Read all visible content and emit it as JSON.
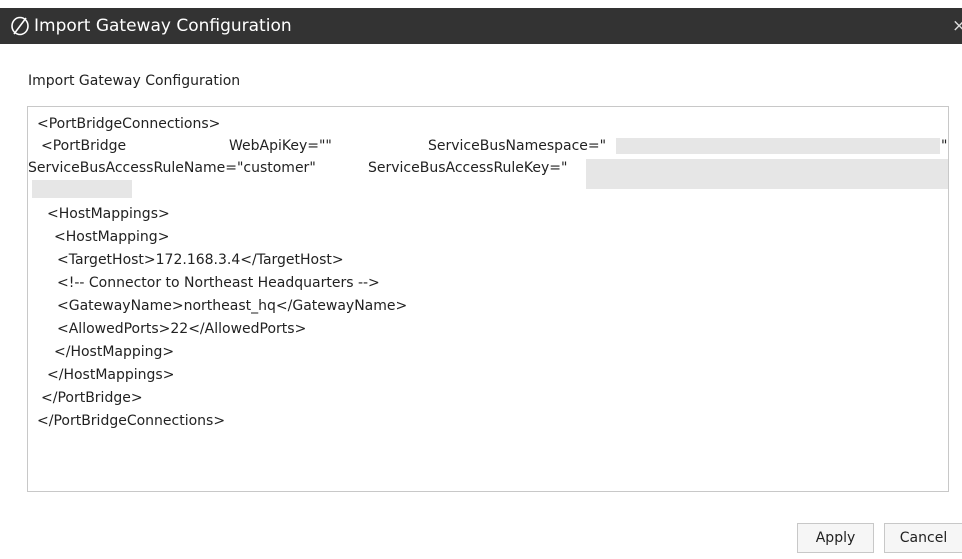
{
  "dialog": {
    "title": "Import Gateway Configuration",
    "close_label": "×",
    "logo_icon": "oracle-logo-icon"
  },
  "section_label": "Import Gateway Configuration",
  "editor": {
    "lines": {
      "l1": "<PortBridgeConnections>",
      "l2a": "<PortBridge",
      "l2b": "WebApiKey=\"\"",
      "l2c": "ServiceBusNamespace=\"",
      "l2d": "\"",
      "l3a": "ServiceBusAccessRuleName=\"customer\"",
      "l3b": "ServiceBusAccessRuleKey=\"",
      "l4": "<HostMappings>",
      "l5": "<HostMapping>",
      "l6": "<TargetHost>172.168.3.4</TargetHost>",
      "l7": "<!-- Connector to Northeast Headquarters -->",
      "l8": "<GatewayName>northeast_hq</GatewayName>",
      "l9": "<AllowedPorts>22</AllowedPorts>",
      "l10": "</HostMapping>",
      "l11": "</HostMappings>",
      "l12": "</PortBridge>",
      "l13": "</PortBridgeConnections>"
    }
  },
  "buttons": {
    "apply": "Apply",
    "cancel": "Cancel"
  },
  "colors": {
    "titlebar": "#333333",
    "redaction": "#e6e6e6",
    "border": "#c8c8c8"
  }
}
